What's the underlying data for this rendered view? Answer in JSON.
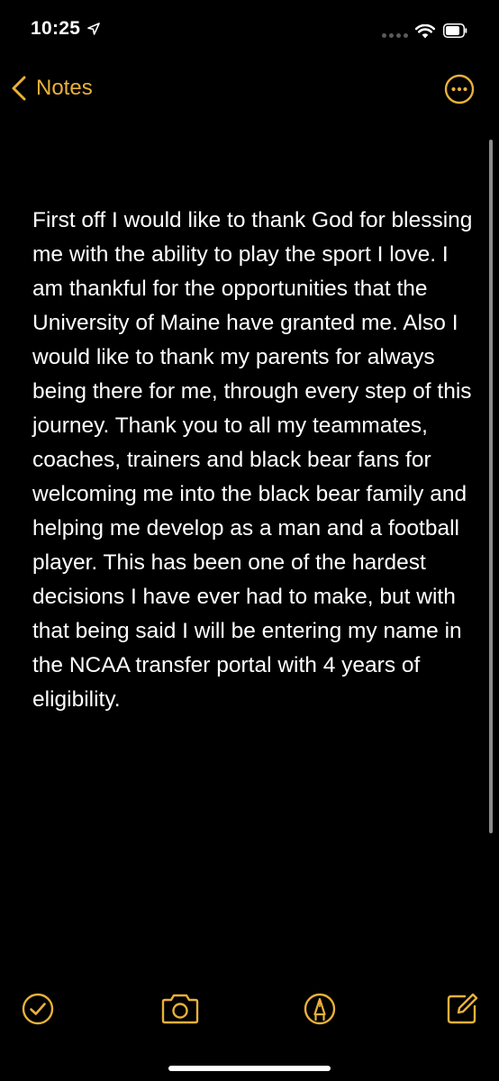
{
  "status_bar": {
    "time": "10:25",
    "icons": [
      "location-arrow-icon",
      "signal-dots-icon",
      "wifi-icon",
      "battery-icon"
    ]
  },
  "nav": {
    "back_label": "Notes",
    "back_icon": "chevron-left-icon",
    "more_icon": "ellipsis-circle-icon"
  },
  "note": {
    "text": "First off I would like to thank God for blessing me with the ability to play the sport I love. I am thankful for the opportunities that the University of Maine have granted me. Also I would like to thank my parents for always being there for me, through every step of this journey. Thank you to all my teammates, coaches, trainers and black bear fans for welcoming me into the black bear family and helping me develop as a man and a football player. This has been one of the hardest decisions I have ever had to make, but with that being said I will be entering my name in the NCAA transfer portal with 4 years of eligibility."
  },
  "toolbar": {
    "icons": [
      "checklist-icon",
      "camera-icon",
      "markup-pen-icon",
      "compose-icon"
    ]
  },
  "colors": {
    "accent": "#e9b13a",
    "background": "#000000",
    "text": "#ffffff"
  }
}
